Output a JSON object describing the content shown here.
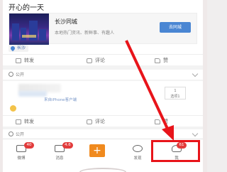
{
  "post1": {
    "title": "开心的一天",
    "share": {
      "name": "长沙同城",
      "desc": "本地热门资讯、新鲜事、有趣人",
      "button": "去同城"
    },
    "location": "长沙"
  },
  "actions": {
    "repost": "转发",
    "comment": "评论",
    "like": "赞"
  },
  "post2": {
    "visibility": "公开",
    "source": "来自iPhone客户端",
    "side_box_line1": "1",
    "side_box_line2": "选项1"
  },
  "post3": {
    "visibility": "公开"
  },
  "tabbar": {
    "items": [
      {
        "label": "微博",
        "badge": "40"
      },
      {
        "label": "消息",
        "badge": "4.6"
      },
      {
        "label": "+",
        "badge": ""
      },
      {
        "label": "发现",
        "badge": ""
      },
      {
        "label": "我",
        "badge": "61"
      }
    ]
  },
  "colors": {
    "accent": "#f08a1e",
    "link": "#4a86d3",
    "badge": "#e23b3b",
    "annotation": "#e8141a"
  }
}
